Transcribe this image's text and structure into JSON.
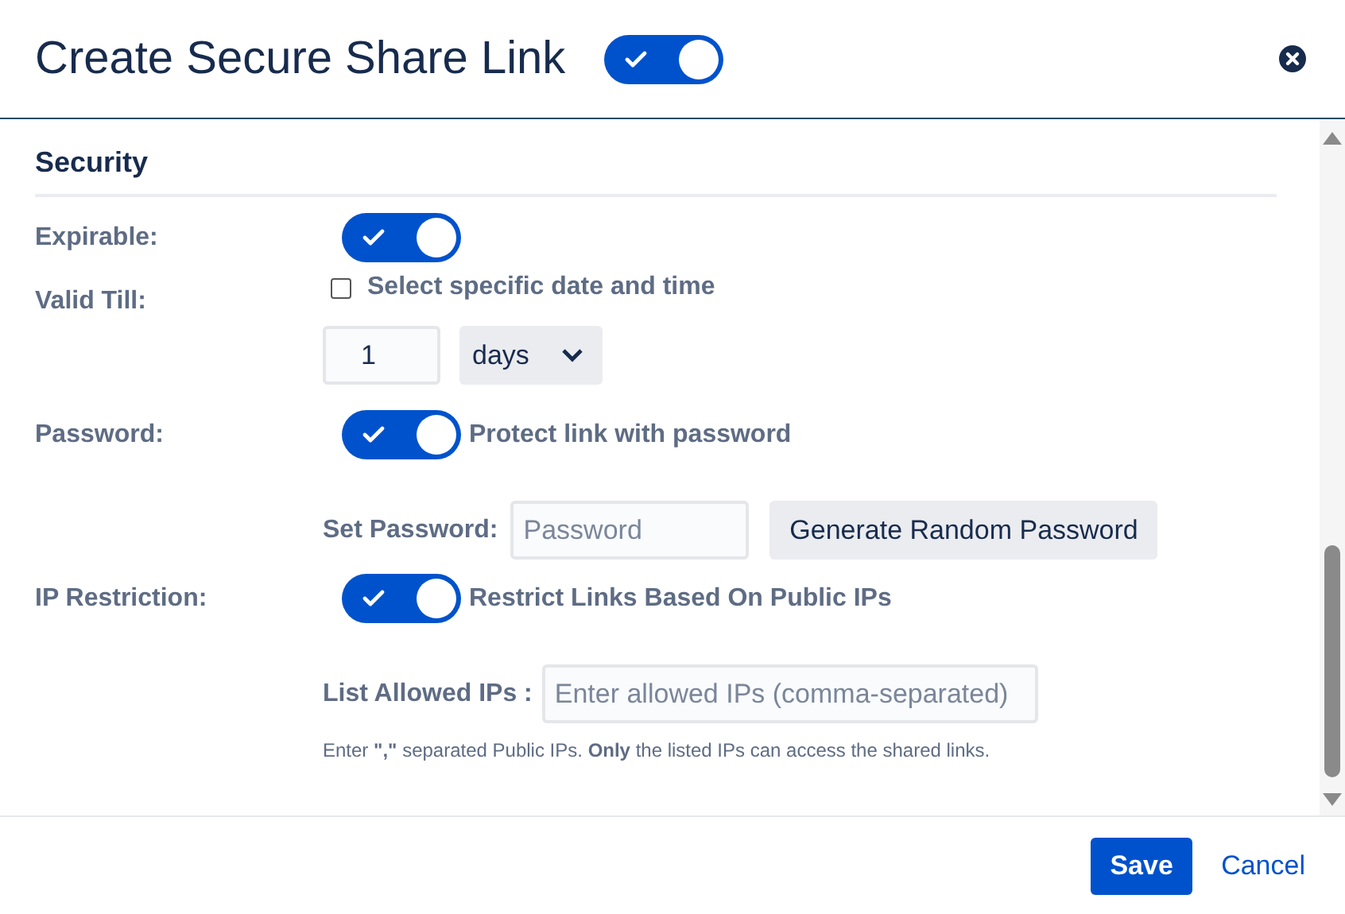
{
  "dialog": {
    "title": "Create Secure Share Link",
    "enabled": true
  },
  "section": {
    "title": "Security"
  },
  "expirable": {
    "label": "Expirable:",
    "on": true
  },
  "valid_till": {
    "label": "Valid Till:",
    "checkbox_label": "Select specific date and time",
    "checked": false,
    "amount": "1",
    "unit": "days"
  },
  "password": {
    "label": "Password:",
    "on": true,
    "toggle_label": "Protect link with password",
    "field_label": "Set Password:",
    "placeholder": "Password",
    "generate_button": "Generate Random Password"
  },
  "ip_restriction": {
    "label": "IP Restriction:",
    "on": true,
    "toggle_label": "Restrict Links Based On Public IPs",
    "field_label": "List Allowed IPs :",
    "placeholder": "Enter allowed IPs (comma-separated)",
    "hint": "Enter **\",\"** separated Public IPs. **Only** the listed IPs can access the shared links."
  },
  "buttons": {
    "save": "Save",
    "cancel": "Cancel"
  }
}
